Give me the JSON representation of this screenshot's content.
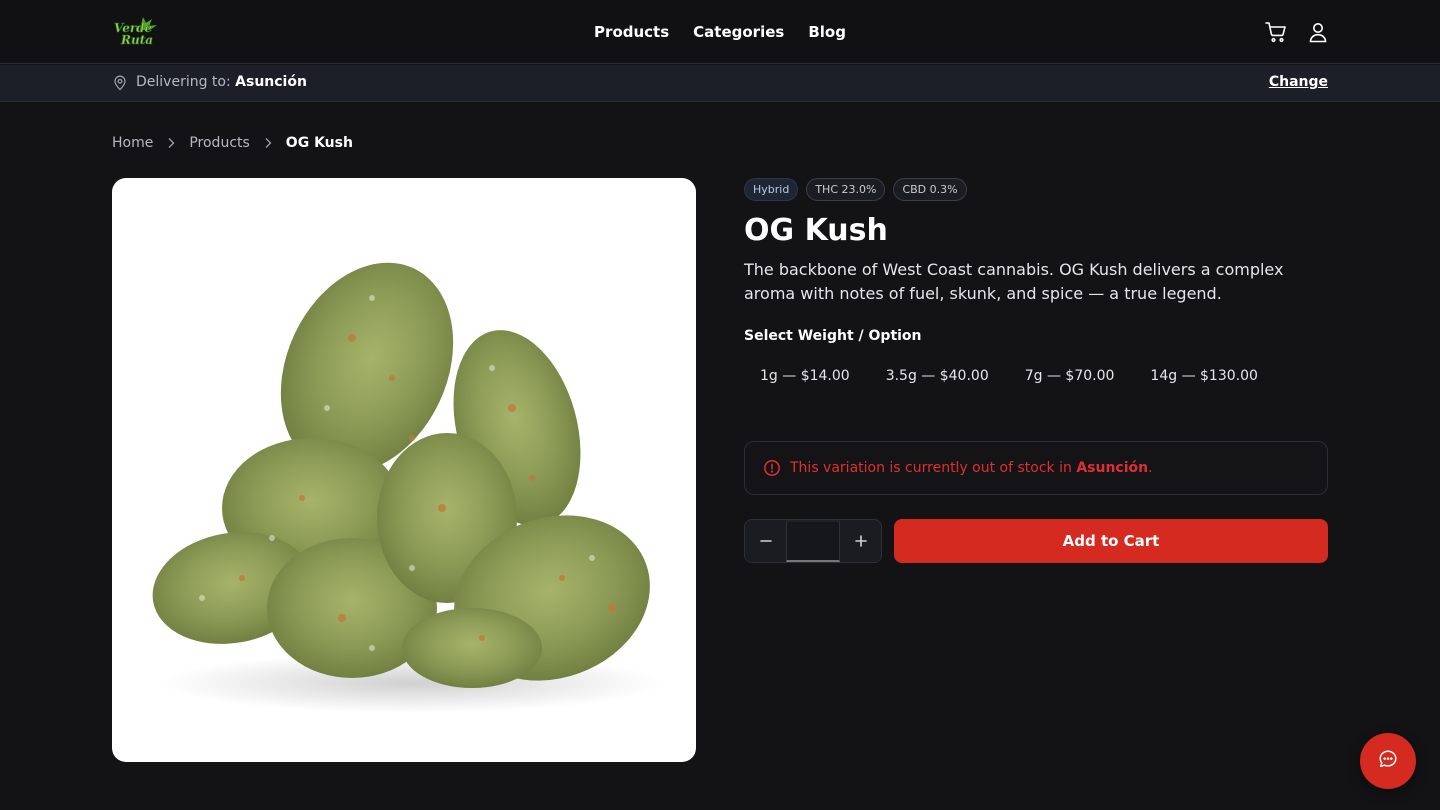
{
  "brand": {
    "logo_text_line1": "Verde",
    "logo_text_line2": "Ruta"
  },
  "nav": {
    "items": [
      "Products",
      "Categories",
      "Blog"
    ]
  },
  "header_icons": [
    "cart-icon",
    "user-icon"
  ],
  "delivery": {
    "prefix": "Delivering to:",
    "location": "Asunción",
    "change_label": "Change"
  },
  "breadcrumb": {
    "home": "Home",
    "products": "Products",
    "current": "OG Kush"
  },
  "product": {
    "badges": [
      "Hybrid",
      "THC 23.0%",
      "CBD 0.3%"
    ],
    "name": "OG Kush",
    "description": "The backbone of West Coast cannabis. OG Kush delivers a complex aroma with notes of fuel, skunk, and spice — a true legend.",
    "select_label": "Select Weight / Option",
    "options": [
      "1g — $14.00",
      "3.5g — $40.00",
      "7g — $70.00",
      "14g — $130.00"
    ]
  },
  "alert": {
    "prefix": "This variation is currently out of stock in ",
    "location": "Asunción",
    "suffix": "."
  },
  "cart": {
    "quantity": "",
    "add_label": "Add to Cart"
  },
  "colors": {
    "accent": "#d42a20",
    "background": "#131316",
    "alert_text": "#e02f2f"
  },
  "chat": {
    "icon": "chat-icon"
  }
}
